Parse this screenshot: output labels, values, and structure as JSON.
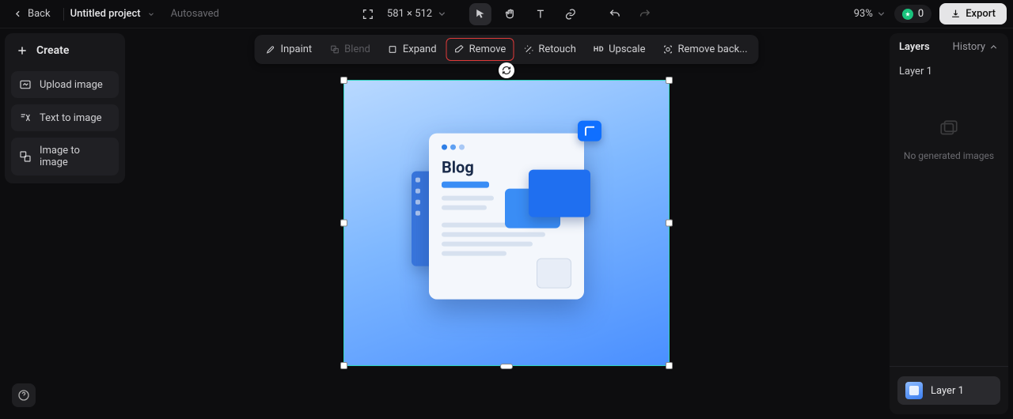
{
  "topbar": {
    "back_label": "Back",
    "project_name": "Untitled project",
    "autosaved_label": "Autosaved",
    "dimensions": "581 × 512",
    "zoom": "93%",
    "credits": "0",
    "export_label": "Export"
  },
  "left_panel": {
    "create_label": "Create",
    "upload_label": "Upload image",
    "text_to_image_label": "Text to image",
    "image_to_image_label": "Image to image"
  },
  "tools": {
    "inpaint": "Inpaint",
    "blend": "Blend",
    "expand": "Expand",
    "remove": "Remove",
    "retouch": "Retouch",
    "upscale": "Upscale",
    "remove_bg": "Remove back..."
  },
  "canvas": {
    "blog_title": "Blog"
  },
  "right_panel": {
    "layers_title": "Layers",
    "history_label": "History",
    "active_layer": "Layer 1",
    "empty_msg": "No generated images",
    "layer_item": "Layer 1"
  },
  "colors": {
    "accent_teal": "#2dd4bf",
    "highlight_red": "#e03a3a",
    "credit_green": "#19c37d"
  }
}
